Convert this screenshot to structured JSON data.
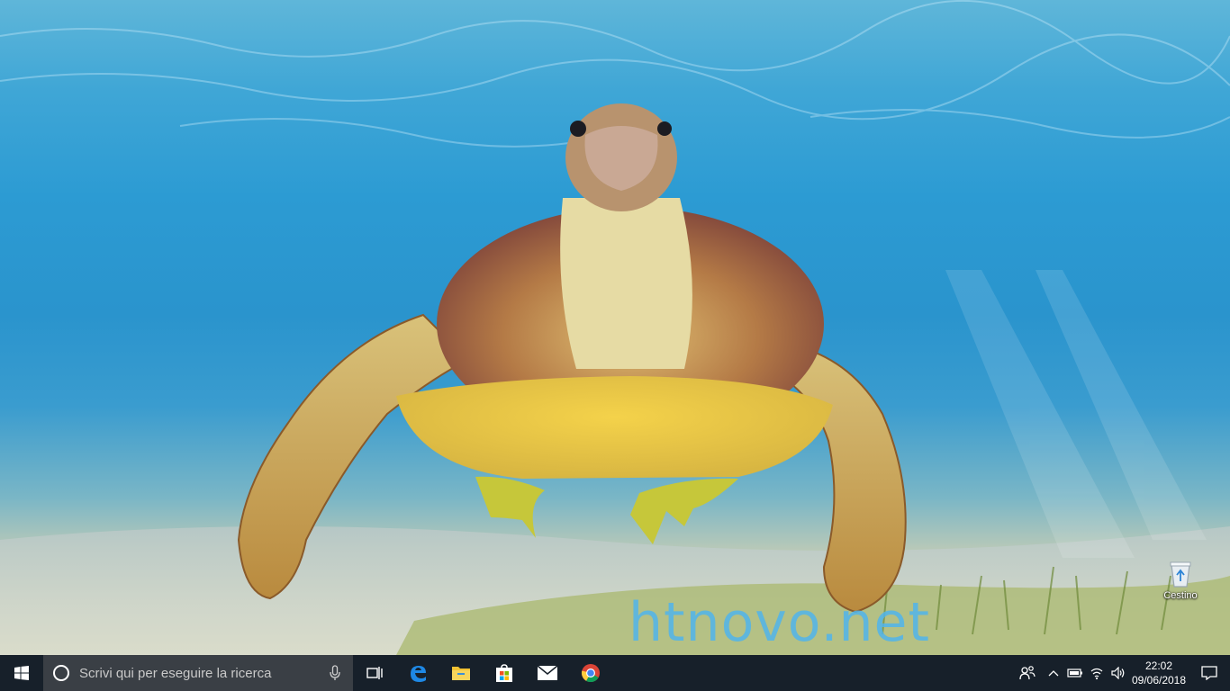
{
  "desktop": {
    "wallpaper": "sea turtle underwater",
    "watermark": "htnovo.net",
    "icons": [
      {
        "label": "Cestino",
        "icon": "recycle-bin-icon"
      }
    ]
  },
  "taskbar": {
    "start_icon": "windows-logo-icon",
    "search": {
      "placeholder": "Scrivi qui per eseguire la ricerca"
    },
    "pinned": [
      "task-view-icon",
      "edge-icon",
      "file-explorer-icon",
      "store-icon",
      "mail-icon",
      "chrome-icon"
    ],
    "tray": {
      "icons": [
        "people-icon",
        "chevron-up-icon",
        "battery-icon",
        "wifi-icon",
        "volume-icon"
      ],
      "time": "22:02",
      "date": "09/06/2018",
      "notification_icon": "action-center-icon"
    }
  },
  "colors": {
    "taskbar": "#17202a",
    "search_box": "#3a3f45",
    "watermark": "#50b4eb"
  }
}
